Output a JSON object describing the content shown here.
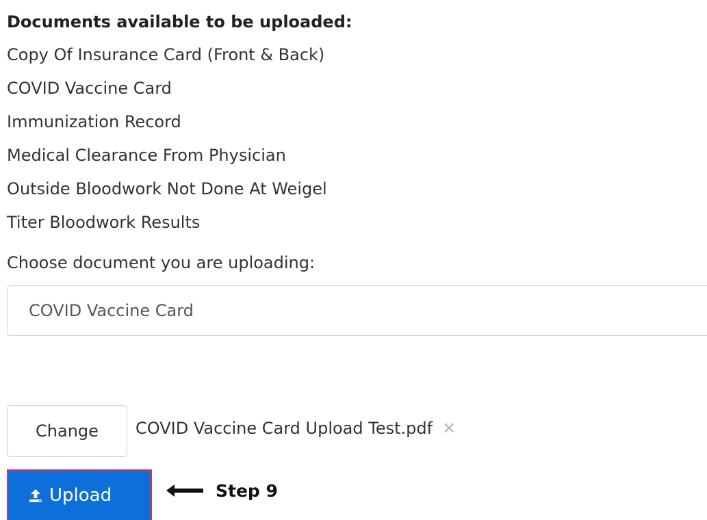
{
  "heading": "Documents available to be uploaded:",
  "documents": [
    "Copy Of Insurance Card (Front & Back)",
    "COVID Vaccine Card",
    "Immunization Record",
    "Medical Clearance From Physician",
    "Outside Bloodwork Not Done At Weigel",
    "Titer Bloodwork Results"
  ],
  "choose_label": "Choose document you are uploading:",
  "select": {
    "selected_value": "COVID Vaccine Card"
  },
  "file": {
    "change_label": "Change",
    "file_name": "COVID Vaccine Card Upload Test.pdf",
    "remove_glyph": "✕"
  },
  "upload": {
    "label": "Upload",
    "icon": "upload-icon"
  },
  "annotation": {
    "step_label": "Step 9",
    "arrow_icon": "left-arrow-icon"
  },
  "colors": {
    "upload_button": "#0d6fd9",
    "upload_highlight_border": "#e2324a"
  }
}
